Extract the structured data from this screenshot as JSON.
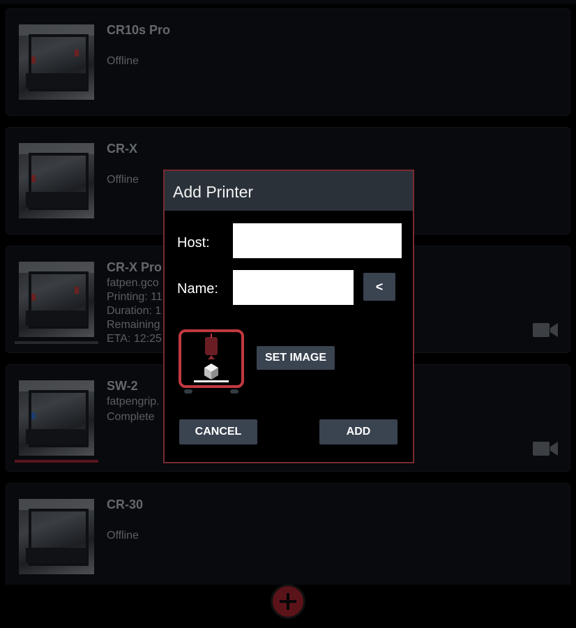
{
  "printers": [
    {
      "name": "CR10s Pro",
      "lines": [
        "Offline"
      ]
    },
    {
      "name": "CR-X",
      "lines": [
        "Offline"
      ]
    },
    {
      "name": "CR-X Pro",
      "lines": [
        "fatpen.gco",
        "Printing: 11",
        "Duration: 1",
        "Remaining",
        "ETA: 12:25"
      ]
    },
    {
      "name": "SW-2",
      "lines": [
        "fatpengrip.",
        "Complete"
      ]
    },
    {
      "name": "CR-30",
      "lines": [
        "Offline"
      ]
    }
  ],
  "dialog": {
    "title": "Add Printer",
    "host_label": "Host:",
    "host_value": "",
    "name_label": "Name:",
    "name_value": "",
    "back_label": "<",
    "set_image_label": "SET IMAGE",
    "cancel_label": "CANCEL",
    "add_label": "ADD"
  },
  "colors": {
    "accent": "#8b1e26",
    "dialog_border": "#7a2a33",
    "header": "#2a3139",
    "button": "#3a4350"
  }
}
